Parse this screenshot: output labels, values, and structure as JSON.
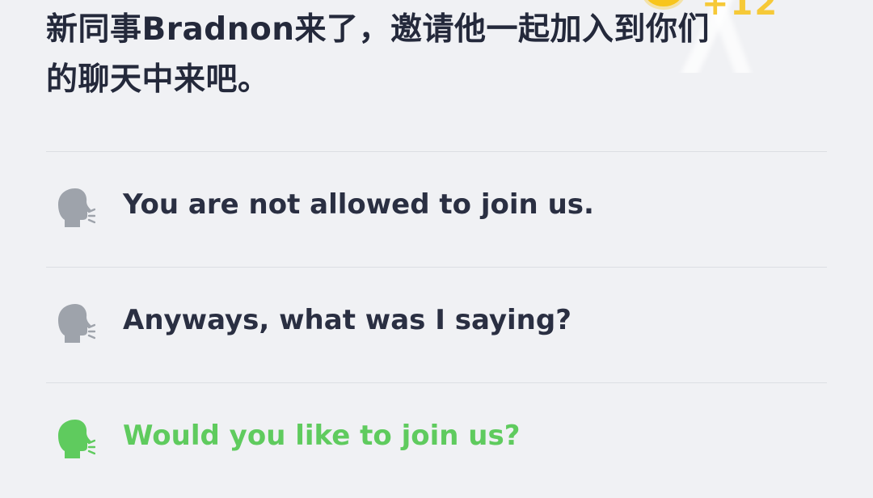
{
  "prompt": {
    "text": "新同事Bradnon来了，邀请他一起加入到你们的聊天中来吧。"
  },
  "header": {
    "score": "+12"
  },
  "options": [
    {
      "label": "You are not allowed to join us.",
      "icon": "speaking-head-icon",
      "selected": false
    },
    {
      "label": "Anyways, what was I saying?",
      "icon": "speaking-head-icon",
      "selected": false
    },
    {
      "label": "Would you like to join us?",
      "icon": "speaking-head-icon",
      "selected": true
    }
  ],
  "colors": {
    "background": "#f0f1f4",
    "text": "#24293b",
    "icon_default": "#9ea3ab",
    "selected": "#5fcb5e",
    "divider": "#dcdee3",
    "score": "#f6c938"
  }
}
